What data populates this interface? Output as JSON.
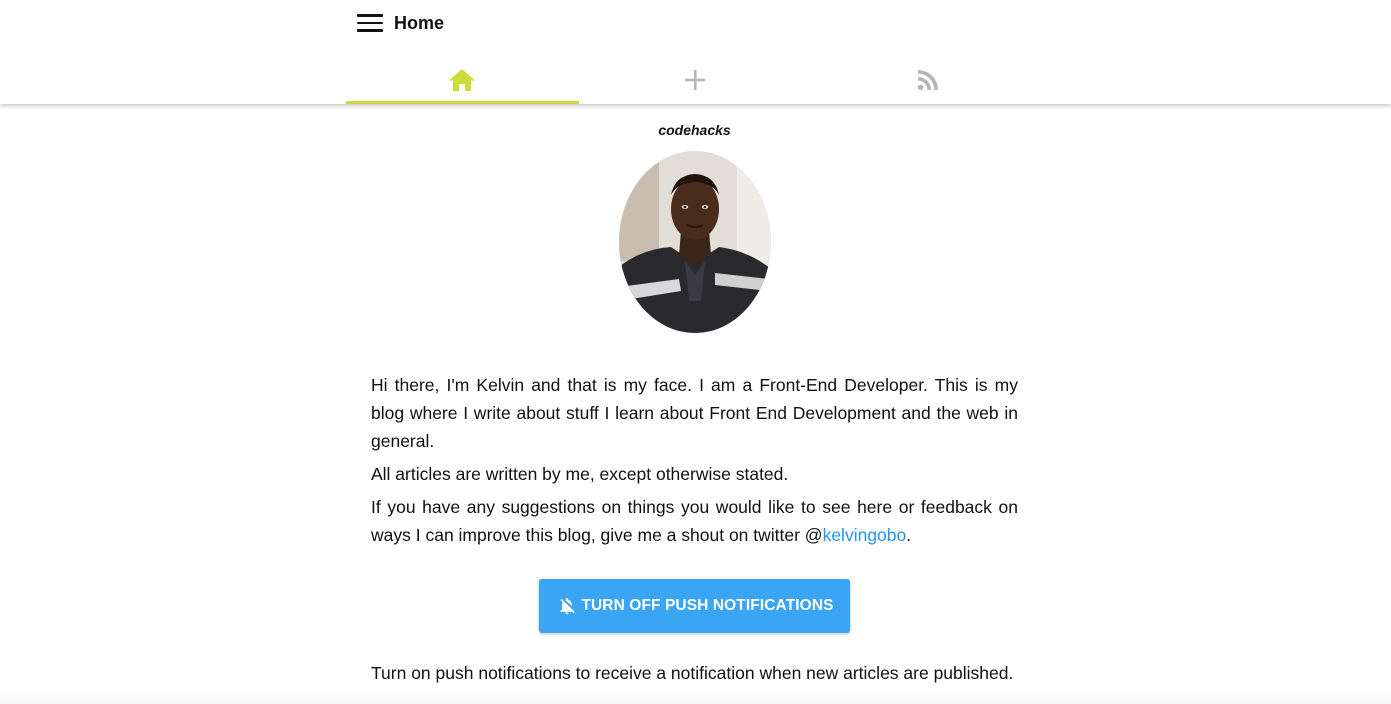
{
  "header": {
    "title": "Home",
    "menu_icon": "hamburger-menu-icon"
  },
  "tabs": [
    {
      "name": "home",
      "icon": "home-icon",
      "active": true,
      "color": "#cddc39"
    },
    {
      "name": "add",
      "icon": "plus-icon",
      "active": false,
      "color": "#b5b5b5"
    },
    {
      "name": "feed",
      "icon": "rss-icon",
      "active": false,
      "color": "#b5b5b5"
    }
  ],
  "profile": {
    "site_name": "codehacks",
    "avatar": "author-photo"
  },
  "bio": {
    "paragraph1": "Hi there, I'm Kelvin and that is my face. I am a Front-End Developer. This is my blog where I write about stuff I learn about Front End Development and the web in general.",
    "paragraph2": "All articles are written by me, except otherwise stated.",
    "paragraph3_prefix": "If you have any suggestions on things you would like to see here or feedback on ways I can improve this blog, give me a shout on twitter @",
    "twitter_handle": "kelvingobo",
    "paragraph3_suffix": "."
  },
  "push_button": {
    "label": "TURN OFF PUSH NOTIFICATIONS",
    "icon": "notifications-off-icon",
    "color": "#3aa5f5"
  },
  "push_note": "Turn on push notifications to receive a notification when new articles are published.",
  "colors": {
    "accent": "#cddc39",
    "link": "#2196f3",
    "button": "#3aa5f5"
  }
}
